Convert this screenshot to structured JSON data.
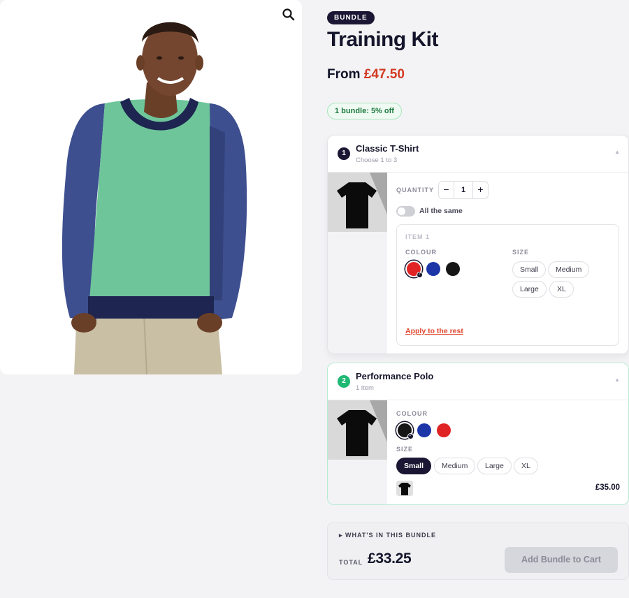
{
  "product": {
    "badge": "BUNDLE",
    "title": "Training Kit",
    "price_prefix": "From",
    "price": "£47.50",
    "discount": "1 bundle: 5% off"
  },
  "gallery": {
    "zoom_icon": "search-icon",
    "image": "model-in-raglan-sweatshirt"
  },
  "bundle_items": [
    {
      "step": "1",
      "title": "Classic T-Shirt",
      "subtitle": "Choose 1 to 3",
      "quantity_label": "QUANTITY",
      "quantity": "1",
      "minus": "−",
      "plus": "+",
      "all_same_label": "All the same",
      "all_same": false,
      "item_label": "ITEM 1",
      "colour_label": "COLOUR",
      "colours": [
        "#e02424",
        "#1c36a8",
        "#161616"
      ],
      "selected_colour": 0,
      "size_label": "SIZE",
      "sizes": [
        "Small",
        "Medium",
        "Large",
        "XL"
      ],
      "apply_label": "Apply to the rest"
    },
    {
      "step": "2",
      "title": "Performance Polo",
      "subtitle": "1 item",
      "colour_label": "COLOUR",
      "colours": [
        "#161616",
        "#1c36a8",
        "#e02424"
      ],
      "selected_colour": 0,
      "size_label": "SIZE",
      "sizes": [
        "Small",
        "Medium",
        "Large",
        "XL"
      ],
      "selected_size": "Small",
      "line_price": "£35.00"
    }
  ],
  "summary": {
    "toggle_label": "▸ WHAT'S IN THIS BUNDLE",
    "total_label": "TOTAL",
    "total": "£33.25",
    "add_button": "Add Bundle to Cart"
  },
  "colors": {
    "accent": "#d23a23",
    "dark": "#1a1633",
    "success": "#1fb874"
  }
}
